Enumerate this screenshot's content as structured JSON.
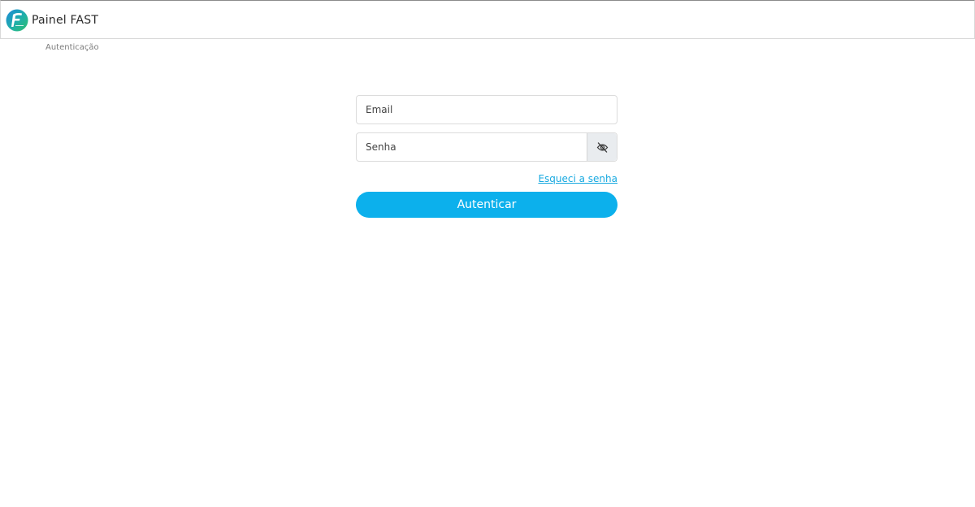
{
  "header": {
    "brand_name": "Painel FAST",
    "logo_text": "Fast"
  },
  "breadcrumb": {
    "current": "Autenticação"
  },
  "login": {
    "email_placeholder": "Email",
    "email_value": "",
    "password_placeholder": "Senha",
    "password_value": "",
    "toggle_icon": "eye-slash-icon",
    "forgot_link": "Esqueci a senha",
    "submit_label": "Autenticar"
  },
  "colors": {
    "accent": "#0cb0ec",
    "link": "#17a9e0",
    "logo_blue": "#1e88d8",
    "logo_green": "#2fbf6a"
  }
}
